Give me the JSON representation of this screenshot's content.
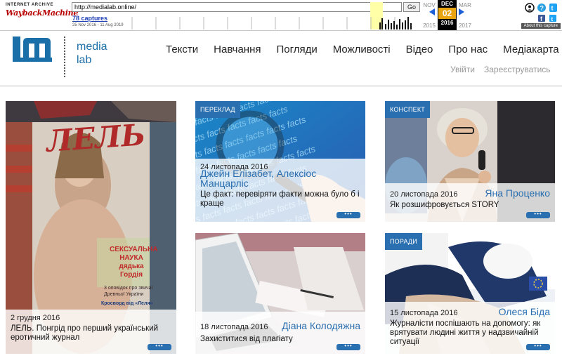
{
  "wayback": {
    "logo_top": "INTERNET ARCHIVE",
    "logo_main": "WaybackMachine",
    "url": "http://medialab.online/",
    "go_label": "Go",
    "captures": "78 captures",
    "date_range": "25 Nov 2016 - 11 Aug 2019",
    "prev_month": "NOV",
    "cur_month": "DEC",
    "next_month": "MAR",
    "prev_year": "2015",
    "cur_day": "02",
    "cur_year": "2016",
    "next_year": "2017",
    "about": "About this capture",
    "colors": {
      "accent": "#e8a50f",
      "link": "#1a3bb3",
      "arrow": "#1a5fd8"
    }
  },
  "site": {
    "logo_word1": "media",
    "logo_word2": "lab",
    "nav": [
      "Тексти",
      "Навчання",
      "Погляди",
      "Можливості",
      "Відео",
      "Про нас",
      "Медіакарта"
    ],
    "login": "Увійти",
    "register": "Зареєструватись",
    "colors": {
      "brand": "#1b6fa8",
      "tag": "#2a6fb0"
    }
  },
  "cards": [
    {
      "tag": "",
      "date": "2 грудня 2016",
      "author": "",
      "title_line1": "ЛЕЛЬ. Понгрід про перший український",
      "title_line2": "еротичний журнал",
      "more": "•••"
    },
    {
      "tag": "ПЕРЕКЛАД",
      "date": "24 листопада 2016",
      "author": "Джейн Елізабет, Алексіос",
      "author_line2": "Манцарліс",
      "title_line1": "Це факт: перевіряти факти можна було б і",
      "title_line2": "краще",
      "more": "•••"
    },
    {
      "tag": "КОНСПЕКТ",
      "date": "20 листопада 2016",
      "author": "Яна Проценко",
      "title_line1": "Як розшифровується STORY",
      "title_line2": "",
      "more": "•••"
    },
    {
      "tag": "",
      "date": "18 листопада 2016",
      "author": "Діана Колодяжна",
      "title_line1": "Захиститися від плагіату",
      "title_line2": "",
      "more": "•••"
    },
    {
      "tag": "ПОРАДИ",
      "date": "15 листопада 2016",
      "author": "Олеся Біда",
      "title_line1": "Журналісти поспішають на допомогу: як",
      "title_line2": "врятувати людині життя у надзвичайній",
      "title_line3": "ситуації",
      "more": "•••"
    }
  ],
  "magazine": {
    "title": "ЛЕЛЬ",
    "cover_line1": "СЕКСУАЛЬНА",
    "cover_line2": "НАУКА",
    "cover_line3": "дядька Гордія",
    "cover_small1": "3 оповідок про звичаї",
    "cover_small2": "Древньої України",
    "cover_bottom": "Кросворд від «Леля»"
  },
  "facts_text": "facts"
}
